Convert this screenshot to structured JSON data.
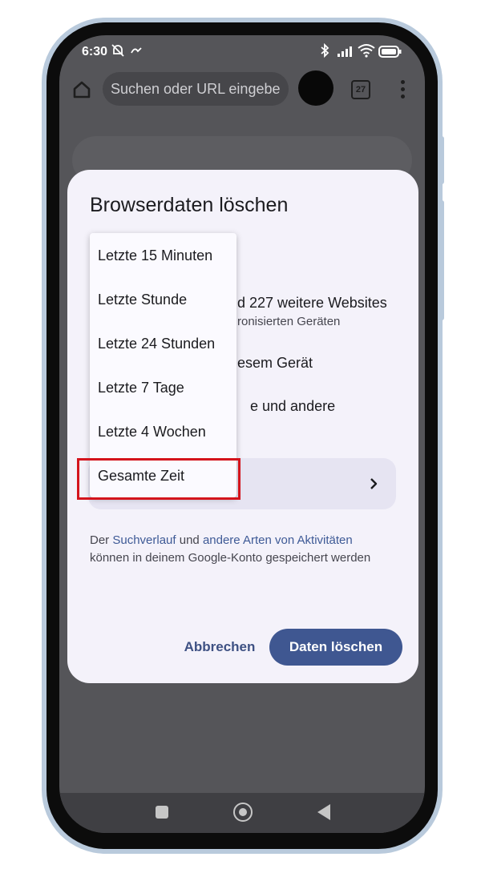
{
  "status_bar": {
    "time": "6:30",
    "icons": [
      "mute-icon",
      "signal-icon",
      "bluetooth-icon",
      "cellular-icon",
      "wifi-icon",
      "battery-icon"
    ]
  },
  "toolbar": {
    "omnibox_placeholder": "Suchen oder URL eingebe",
    "tab_count": "27"
  },
  "dialog": {
    "title": "Browserdaten löschen",
    "partial_rows": [
      {
        "main": "d 227 weitere Websites",
        "sub": "ronisierten Geräten"
      },
      {
        "main": "esem Gerät"
      },
      {
        "main": "e und andere"
      }
    ],
    "info_parts": {
      "t1": "Der ",
      "link1": "Suchverlauf",
      "t2": " und ",
      "link2": "andere Arten von Aktivitäten",
      "t3": " können in deinem Google-Konto gespeichert werden"
    },
    "cancel_label": "Abbrechen",
    "confirm_label": "Daten löschen"
  },
  "dropdown": {
    "options": [
      "Letzte 15 Minuten",
      "Letzte Stunde",
      "Letzte 24 Stunden",
      "Letzte 7 Tage",
      "Letzte 4 Wochen",
      "Gesamte Zeit"
    ],
    "highlighted": "Gesamte Zeit"
  },
  "colors": {
    "accent": "#3f5791",
    "highlight_border": "#d4141c",
    "dialog_bg": "#f4f2fa"
  }
}
